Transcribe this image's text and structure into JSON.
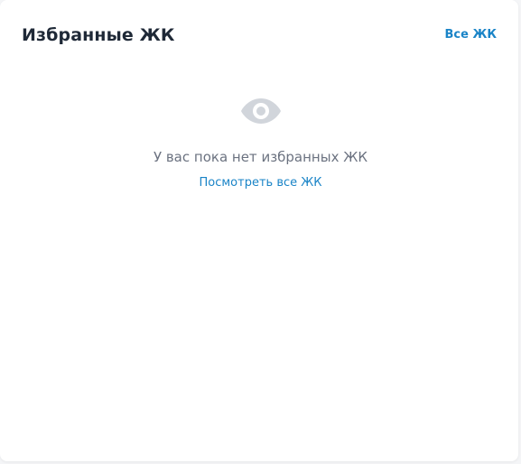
{
  "header": {
    "title": "Избранные ЖК",
    "all_link": "Все ЖК"
  },
  "empty_state": {
    "icon": "eye-icon",
    "message": "У вас пока нет избранных ЖК",
    "link": "Посмотреть все ЖК"
  },
  "colors": {
    "accent": "#1a84c7",
    "title": "#1f2937",
    "muted_text": "#6b7280",
    "icon": "#d1d5db"
  }
}
